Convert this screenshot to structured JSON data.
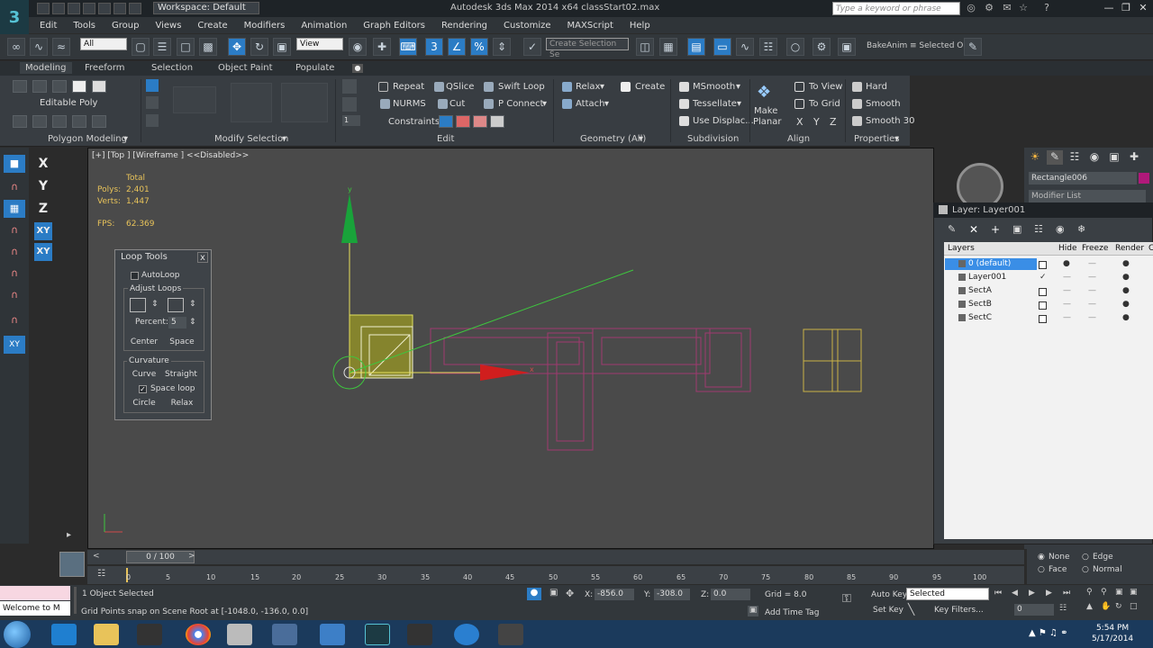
{
  "title_bar": {
    "workspace": "Workspace: Default",
    "app_title": "Autodesk 3ds Max 2014 x64     classStart02.max",
    "search_placeholder": "Type a keyword or phrase"
  },
  "menu": [
    "Edit",
    "Tools",
    "Group",
    "Views",
    "Create",
    "Modifiers",
    "Animation",
    "Graph Editors",
    "Rendering",
    "Customize",
    "MAXScript",
    "Help"
  ],
  "toolbar": {
    "filter": "All",
    "reference": "View",
    "selection_set": "Create Selection Se",
    "bake": "BakeAnim",
    "selected_obj": "≡ Selected Obj"
  },
  "ribbon_tabs": [
    "Modeling",
    "Freeform",
    "Selection",
    "Object Paint",
    "Populate"
  ],
  "ribbon": {
    "editable_poly": "Editable Poly",
    "polygon_modeling": "Polygon Modeling",
    "modify_selection": "Modify Selection",
    "edit": {
      "repeat": "Repeat",
      "qslice": "QSlice",
      "swift_loop": "Swift Loop",
      "nurms": "NURMS",
      "cut": "Cut",
      "p_connect": "P Connect",
      "constraints": "Constraints:",
      "footer": "Edit"
    },
    "geometry": {
      "relax": "Relax",
      "create": "Create",
      "attach": "Attach",
      "footer": "Geometry (All)"
    },
    "subdivision": {
      "msmooth": "MSmooth",
      "tessellate": "Tessellate",
      "use_displace": "Use Displac...",
      "footer": "Subdivision"
    },
    "align": {
      "make": "Make",
      "planar": "Planar",
      "to_view": "To View",
      "to_grid": "To Grid",
      "x": "X",
      "y": "Y",
      "z": "Z",
      "footer": "Align"
    },
    "properties": {
      "hard": "Hard",
      "smooth": "Smooth",
      "smooth30": "Smooth 30",
      "footer": "Properties"
    }
  },
  "axis_buttons": [
    "X",
    "Y",
    "Z",
    "XY",
    "XY"
  ],
  "viewport": {
    "label": "[+] [Top ] [Wireframe ] <<Disabled>>",
    "stats_header": "Total",
    "polys_label": "Polys:",
    "polys_value": "2,401",
    "verts_label": "Verts:",
    "verts_value": "1,447",
    "fps_label": "FPS:",
    "fps_value": "62.369",
    "gizmo_y": "y",
    "gizmo_x": "x"
  },
  "loop_tools": {
    "title": "Loop Tools",
    "close": "x",
    "autoloop": "AutoLoop",
    "adjust_loops": "Adjust Loops",
    "percent_label": "Percent:",
    "percent_value": "5",
    "center": "Center",
    "space": "Space",
    "curvature": "Curvature",
    "curve": "Curve",
    "straight": "Straight",
    "space_loop": "Space loop",
    "circle": "Circle",
    "relax": "Relax"
  },
  "command_panel": {
    "object_name": "Rectangle006",
    "modifier_list": "Modifier List"
  },
  "layer_window": {
    "title": "Layer: Layer001",
    "columns": [
      "Layers",
      "Hide",
      "Freeze",
      "Render",
      "C"
    ],
    "rows": [
      {
        "name": "0 (default)",
        "selected": true
      },
      {
        "name": "Layer001",
        "selected": false
      },
      {
        "name": "SectA",
        "selected": false
      },
      {
        "name": "SectB",
        "selected": false
      },
      {
        "name": "SectC",
        "selected": false
      }
    ]
  },
  "timeline": {
    "frame": "0 / 100",
    "ticks": [
      "0",
      "5",
      "10",
      "15",
      "20",
      "25",
      "30",
      "35",
      "40",
      "45",
      "50",
      "55",
      "60",
      "65",
      "70",
      "75",
      "80",
      "85",
      "90",
      "95",
      "100"
    ]
  },
  "status": {
    "maxscript": "Welcome to M",
    "selected": "1 Object Selected",
    "prompt": "Grid Points snap on Scene Root at [-1048.0, -136.0, 0.0]",
    "x_label": "X:",
    "x_value": "-856.0",
    "y_label": "Y:",
    "y_value": "-308.0",
    "z_label": "Z:",
    "z_value": "0.0",
    "grid": "Grid = 8.0",
    "add_time_tag": "Add Time Tag",
    "auto_key": "Auto Key",
    "set_key": "Set Key",
    "key_mode": "Selected",
    "key_filters": "Key Filters...",
    "frame_field": "0",
    "none": "None",
    "edge": "Edge",
    "face": "Face",
    "normal": "Normal"
  },
  "taskbar": {
    "time": "5:54 PM",
    "date": "5/17/2014"
  }
}
